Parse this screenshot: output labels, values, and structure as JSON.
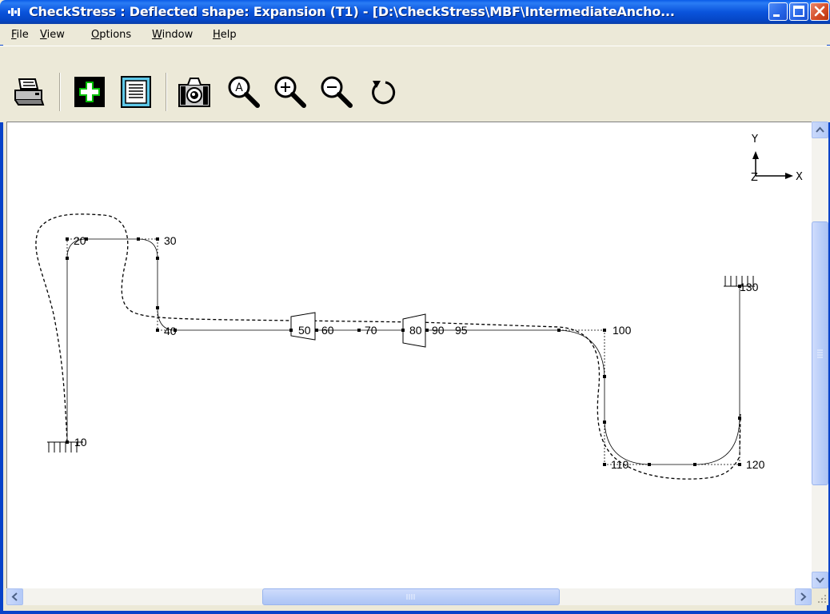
{
  "window": {
    "title": "CheckStress : Deflected shape: Expansion (T1) -  [D:\\CheckStress\\MBF\\IntermediateAncho...",
    "colors": {
      "titlebar": "#0a54dc",
      "close": "#d34a24",
      "canvas": "#ffffff"
    }
  },
  "menu": [
    {
      "key": "F",
      "rest": "ile"
    },
    {
      "key": "V",
      "rest": "iew"
    },
    {
      "key": "O",
      "rest": "ptions"
    },
    {
      "key": "W",
      "rest": "indow"
    },
    {
      "key": "H",
      "rest": "elp"
    }
  ],
  "toolbar": {
    "icons": [
      "print-icon",
      "add-node-icon",
      "report-icon",
      "camera-icon",
      "zoom-all-icon",
      "zoom-in-icon",
      "zoom-out-icon",
      "rotate-icon"
    ]
  },
  "axes": {
    "y": "Y",
    "x": "X",
    "z": "Z"
  },
  "nodes": [
    "10",
    "20",
    "30",
    "40",
    "50",
    "60",
    "70",
    "80",
    "90",
    "95",
    "100",
    "110",
    "120",
    "130"
  ]
}
